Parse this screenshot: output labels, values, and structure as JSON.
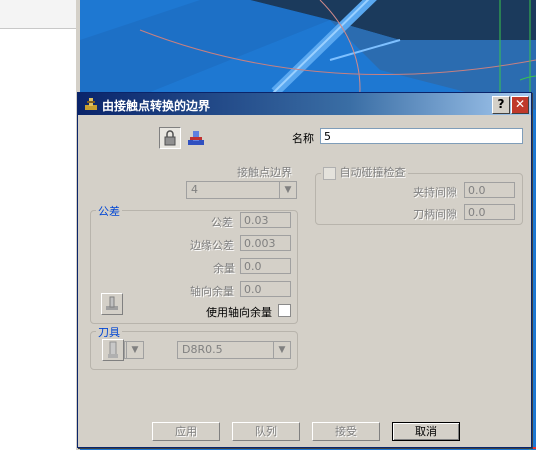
{
  "dialog": {
    "title": "由接触点转换的边界",
    "help_label": "?",
    "close_label": "✕",
    "name_label": "名称",
    "name_value": "5"
  },
  "contact": {
    "label": "接触点边界",
    "value": "4"
  },
  "collision": {
    "label": "自动碰撞检查",
    "checked": false,
    "holder_clearance_label": "夹持间隙",
    "holder_clearance_value": "0.0",
    "shank_clearance_label": "刀柄间隙",
    "shank_clearance_value": "0.0"
  },
  "tolerance_group": {
    "title": "公差",
    "tolerance_label": "公差",
    "tolerance_value": "0.03",
    "boundary_tolerance_label": "边缘公差",
    "boundary_tolerance_value": "0.003",
    "thickness_label": "余量",
    "thickness_value": "0.0",
    "axial_thickness_label": "轴向余量",
    "axial_thickness_value": "0.0",
    "use_axial_label": "使用轴向余量",
    "use_axial_checked": false
  },
  "tool_group": {
    "title": "刀具",
    "tool_value": "D8R0.5"
  },
  "buttons": {
    "apply": "应用",
    "queue": "队列",
    "accept": "接受",
    "cancel": "取消"
  },
  "icons": [
    "lock-icon",
    "tool-stack-icon",
    "thickness-icon",
    "tool-holder-icon",
    "dropdown-arrow-icon",
    "help-icon",
    "close-icon"
  ]
}
